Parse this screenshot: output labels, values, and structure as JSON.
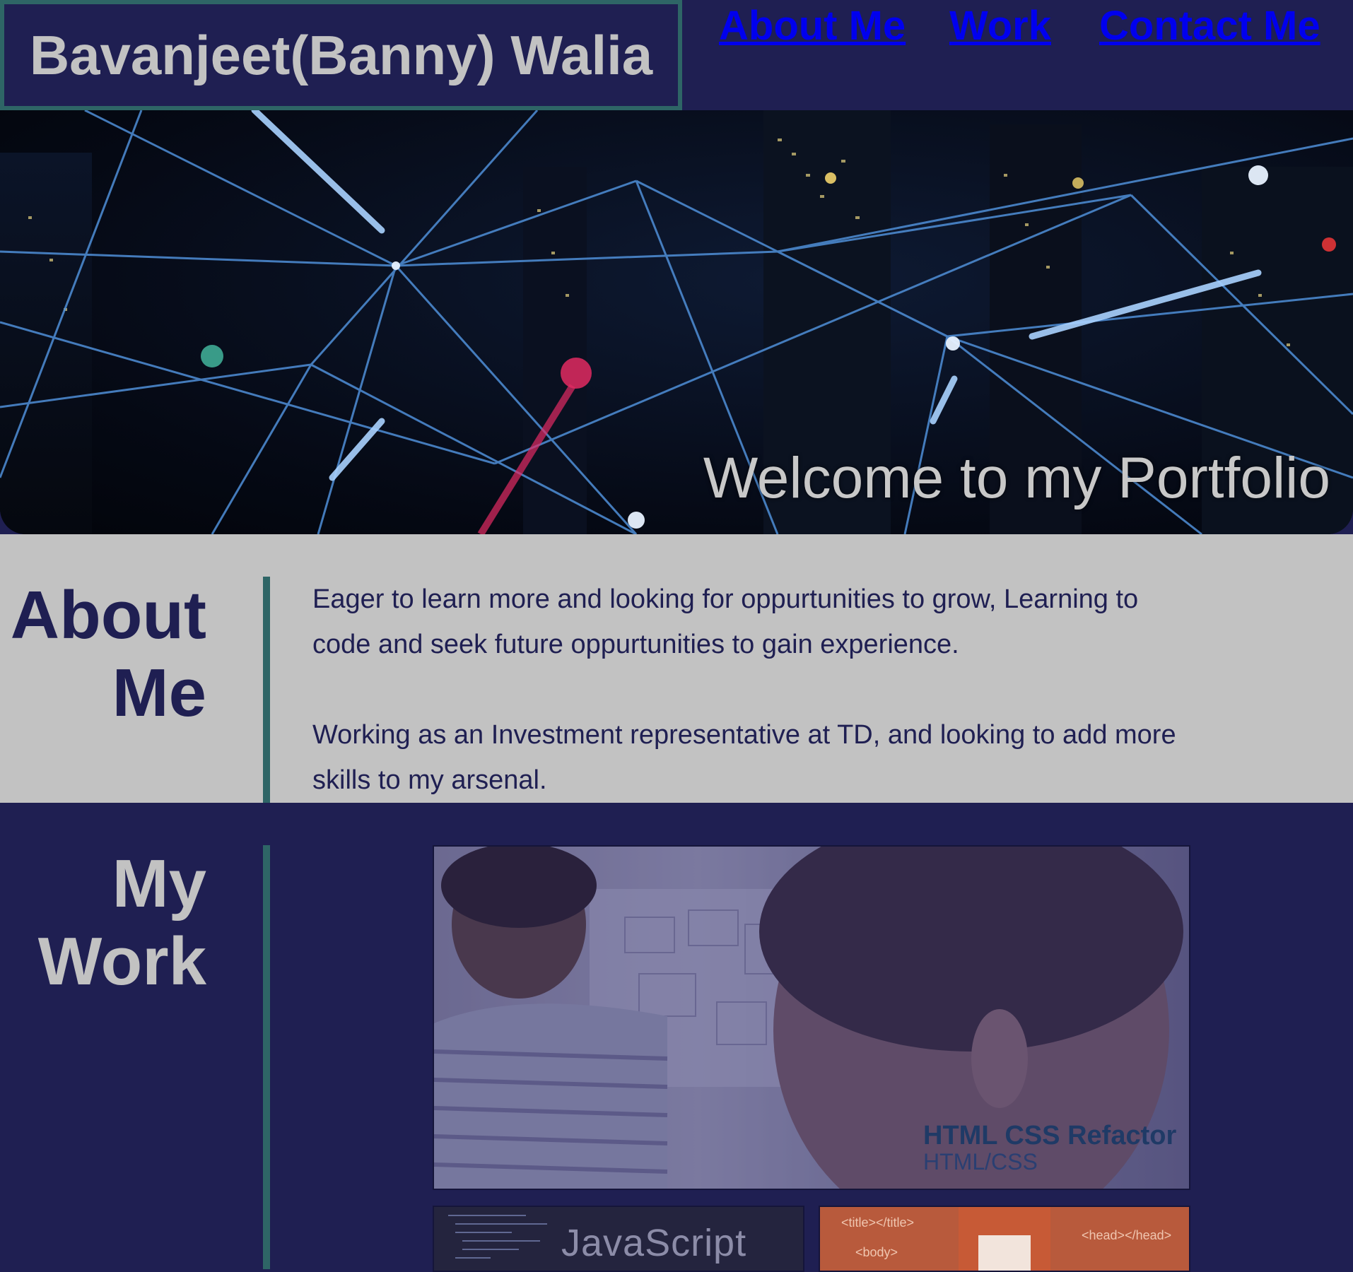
{
  "header": {
    "title": "Bavanjeet(Banny) Walia",
    "nav": {
      "about": "About Me",
      "work": "Work",
      "contact": "Contact Me"
    }
  },
  "hero": {
    "caption": "Welcome to my Portfolio"
  },
  "about": {
    "heading_line1": "About",
    "heading_line2": "Me",
    "paragraphs": [
      "Eager to learn more and looking for oppurtunities to grow, Learning to code and seek future oppurtunities to gain experience.",
      "Working as an Investment representative at TD, and looking to add more skills to my arsenal."
    ]
  },
  "work": {
    "heading_line1": "My",
    "heading_line2": "Work",
    "projects": [
      {
        "title": "HTML CSS Refactor",
        "tech": "HTML/CSS"
      },
      {
        "label": "JavaScript"
      },
      {
        "tags": [
          "<title></title>",
          "<head></head>",
          "<body>"
        ]
      }
    ]
  },
  "colors": {
    "navy": "#1f1f52",
    "gray": "#c2c2c2",
    "teal": "#2e6566",
    "link": "#0000ee"
  }
}
